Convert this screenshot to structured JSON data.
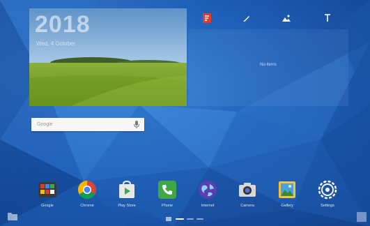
{
  "widget": {
    "year": "2018",
    "subtitle": "Wed, 4 October"
  },
  "toolbar": {
    "icons": [
      "scrapbook-icon",
      "pen-icon",
      "camera-note-icon",
      "text-icon"
    ]
  },
  "note_panel": {
    "empty_text": "No items"
  },
  "search": {
    "label": "Google",
    "placeholder": "Google"
  },
  "dock": {
    "apps": [
      {
        "label": "Google",
        "icon": "google-folder-icon"
      },
      {
        "label": "Chrome",
        "icon": "chrome-icon"
      },
      {
        "label": "Play Store",
        "icon": "play-store-icon"
      },
      {
        "label": "Phone",
        "icon": "phone-icon"
      },
      {
        "label": "Internet",
        "icon": "internet-icon"
      },
      {
        "label": "Camera",
        "icon": "camera-icon"
      },
      {
        "label": "Gallery",
        "icon": "gallery-icon"
      },
      {
        "label": "Settings",
        "icon": "settings-icon"
      }
    ]
  },
  "page_indicator": {
    "pages": 4,
    "current": 1
  },
  "colors": {
    "wallpaper": "#1d5fb8",
    "accent_red": "#e03c2a",
    "phone_green": "#3fa745"
  }
}
